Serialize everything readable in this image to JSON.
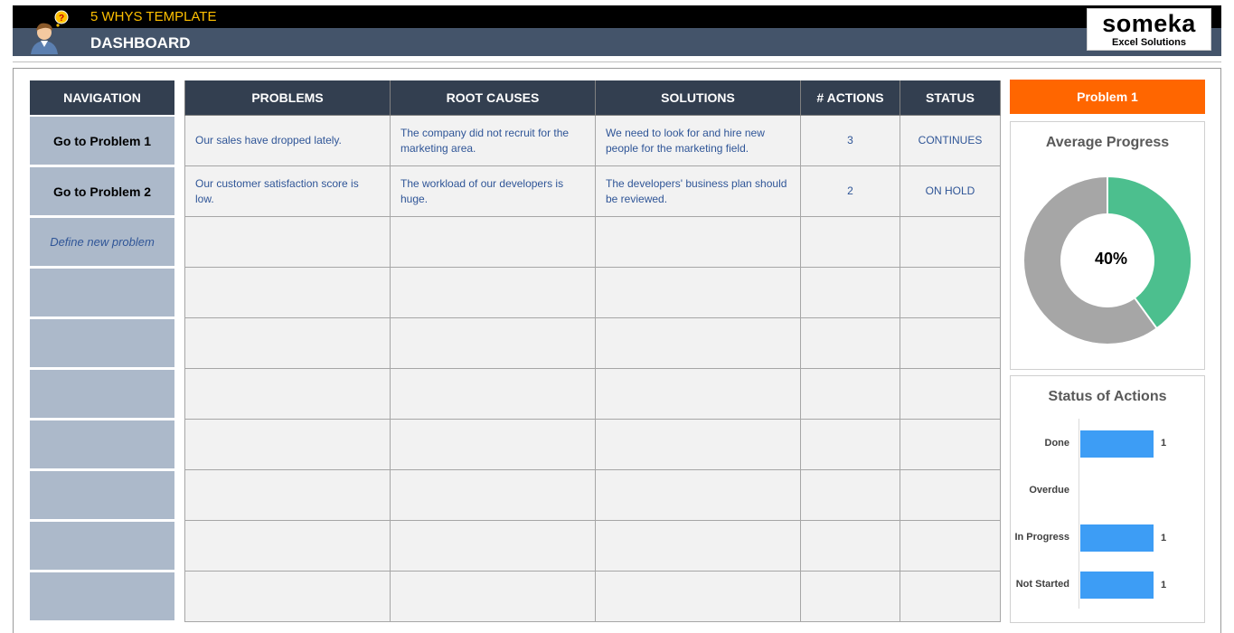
{
  "header": {
    "app_title": "5 WHYS TEMPLATE",
    "page_title": "DASHBOARD",
    "logo_name": "someka",
    "logo_sub": "Excel Solutions"
  },
  "navigation": {
    "header": "NAVIGATION",
    "items": [
      "Go to Problem 1",
      "Go to Problem 2",
      "Define new problem",
      "",
      "",
      "",
      "",
      "",
      "",
      ""
    ]
  },
  "table": {
    "columns": [
      "PROBLEMS",
      "ROOT CAUSES",
      "SOLUTIONS",
      "# ACTIONS",
      "STATUS"
    ],
    "rows": [
      [
        "Our sales have dropped lately.",
        "The company did not recruit for the marketing area.",
        "We need to look for and hire new people for the marketing field.",
        "3",
        "CONTINUES"
      ],
      [
        "Our customer satisfaction score is low.",
        "The workload of our developers is huge.",
        "The developers' business plan should be reviewed.",
        "2",
        "ON HOLD"
      ],
      [
        "",
        "",
        "",
        "",
        ""
      ],
      [
        "",
        "",
        "",
        "",
        ""
      ],
      [
        "",
        "",
        "",
        "",
        ""
      ],
      [
        "",
        "",
        "",
        "",
        ""
      ],
      [
        "",
        "",
        "",
        "",
        ""
      ],
      [
        "",
        "",
        "",
        "",
        ""
      ],
      [
        "",
        "",
        "",
        "",
        ""
      ],
      [
        "",
        "",
        "",
        "",
        ""
      ]
    ]
  },
  "side": {
    "problem_badge": "Problem 1",
    "progress_title": "Average Progress",
    "progress_label": "40%",
    "progress_value": 0.4,
    "actions_title": "Status of Actions"
  },
  "colors": {
    "progress_done": "#4cbf8e",
    "progress_remaining": "#a6a6a6",
    "bar": "#3d9df5",
    "accent": "#ff6600",
    "header_dark": "#333f50"
  },
  "chart_data": {
    "type": "bar",
    "orientation": "horizontal",
    "title": "Status of Actions",
    "categories": [
      "Done",
      "Overdue",
      "In Progress",
      "Not Started"
    ],
    "values": [
      1,
      0,
      1,
      1
    ],
    "data_labels": [
      "1",
      "",
      "1",
      "1"
    ]
  }
}
